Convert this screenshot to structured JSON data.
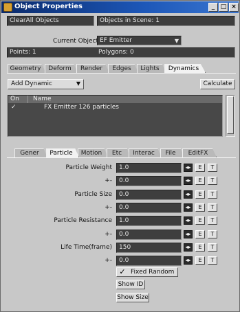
{
  "window": {
    "title": "Object Properties",
    "controls": {
      "minimize": "_",
      "maximize": "□",
      "close": "×"
    }
  },
  "top": {
    "clear_all": "ClearAll Objects",
    "objects_in_scene": "Objects in Scene: 1",
    "current_object_label": "Current Object",
    "current_object_value": "EF Emitter",
    "points": "Points: 1",
    "polygons": "Polygons: 0"
  },
  "main_tabs": [
    "Geometry",
    "Deform",
    "Render",
    "Edges",
    "Lights",
    "Dynamics"
  ],
  "main_tab_active": "Dynamics",
  "dynamics": {
    "add_dynamic": "Add Dynamic",
    "calculate": "Calculate",
    "list_headers": [
      "On",
      "Name"
    ],
    "list_rows": [
      {
        "on": "✓",
        "name": "FX Emitter 126 particles"
      }
    ]
  },
  "sub_tabs": [
    "Gener",
    "Particle",
    "Motion",
    "Etc",
    "Interac",
    "File",
    "EditFX"
  ],
  "sub_tab_active": "Particle",
  "params": [
    {
      "label": "Particle Weight",
      "value": "1.0"
    },
    {
      "label": "+-",
      "value": "0.0"
    },
    {
      "label": "Particle Size",
      "value": "0.0"
    },
    {
      "label": "+-",
      "value": "0.0"
    },
    {
      "label": "Particle Resistance",
      "value": "1.0"
    },
    {
      "label": "+-",
      "value": "0.0"
    },
    {
      "label": "Life Time(frame)",
      "value": "150"
    },
    {
      "label": "+-",
      "value": "0.0"
    }
  ],
  "param_buttons": {
    "envelope": "◂▸",
    "e": "E",
    "t": "T"
  },
  "options": {
    "fixed_random": "Fixed Random",
    "fixed_random_checked": "✓",
    "show_id": "Show ID",
    "show_size": "Show Size"
  }
}
